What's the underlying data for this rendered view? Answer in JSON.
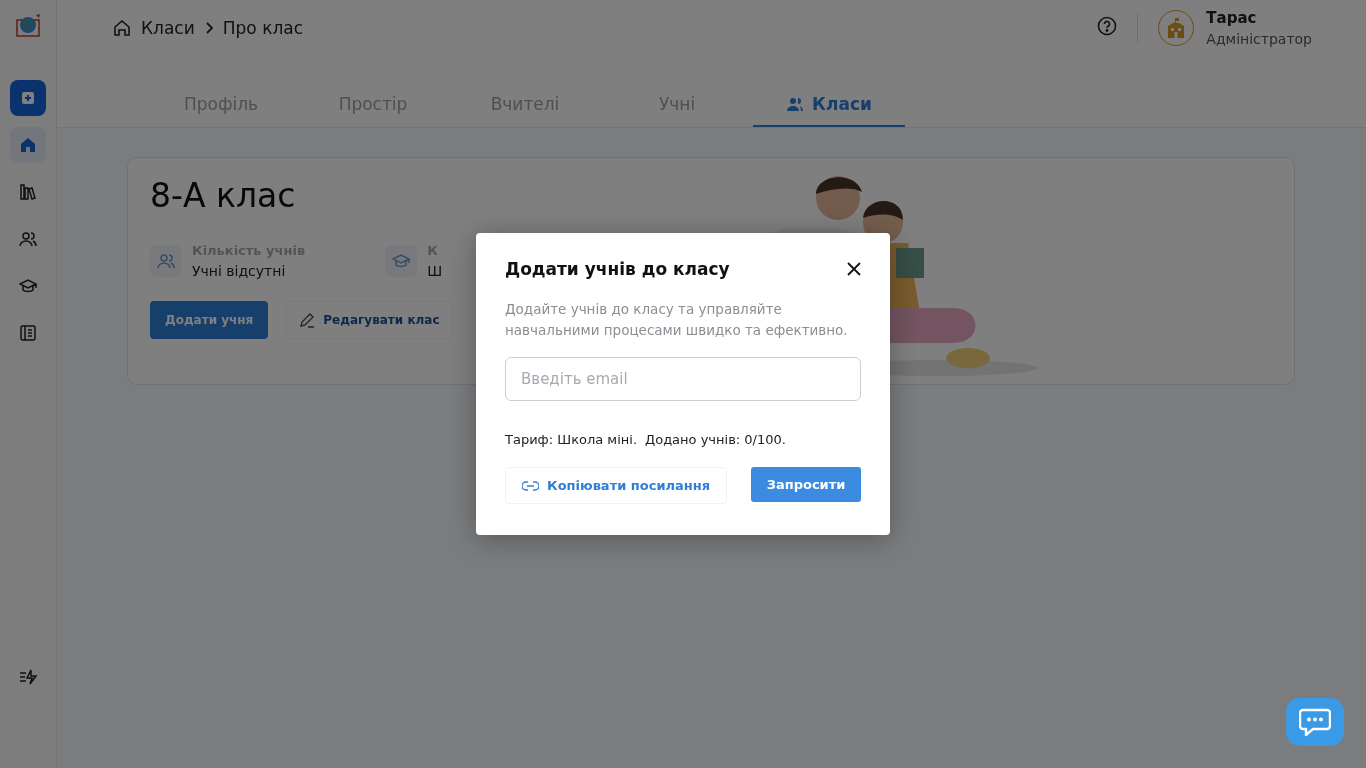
{
  "sidebar": {
    "items": [
      {
        "kind": "home",
        "selected": true
      },
      {
        "kind": "library",
        "selected": false
      },
      {
        "kind": "users",
        "selected": false
      },
      {
        "kind": "graduation",
        "selected": false
      },
      {
        "kind": "journal",
        "selected": false
      }
    ]
  },
  "breadcrumb": [
    "Класи",
    "Про клас"
  ],
  "user": {
    "name": "Тарас",
    "role": "Адміністратор"
  },
  "tabs": [
    {
      "label": "Профіль",
      "selected": false
    },
    {
      "label": "Простір",
      "selected": false
    },
    {
      "label": "Вчителі",
      "selected": false
    },
    {
      "label": "Учні",
      "selected": false
    },
    {
      "label": "Класи",
      "selected": true
    }
  ],
  "card": {
    "title": "8-А клас",
    "stats": [
      {
        "kind": "users",
        "label": "Кількість учнів",
        "value": "Учні відсутні"
      },
      {
        "kind": "graduation",
        "label": "К",
        "value": "Ш"
      }
    ],
    "primary_button": "Додати учня",
    "edit_button": "Редагувати клас"
  },
  "modal": {
    "title": "Додати учнів до класу",
    "description": "Додайте учнів до класу та управляйте навчальними процесами швидко та ефективно.",
    "email": {
      "placeholder": "Введіть email"
    },
    "tariff": "Тариф: Школа міні.",
    "added": "Додано учнів: 0/100.",
    "copy_button": "Копіювати посилання",
    "invite_button": "Запросити"
  }
}
